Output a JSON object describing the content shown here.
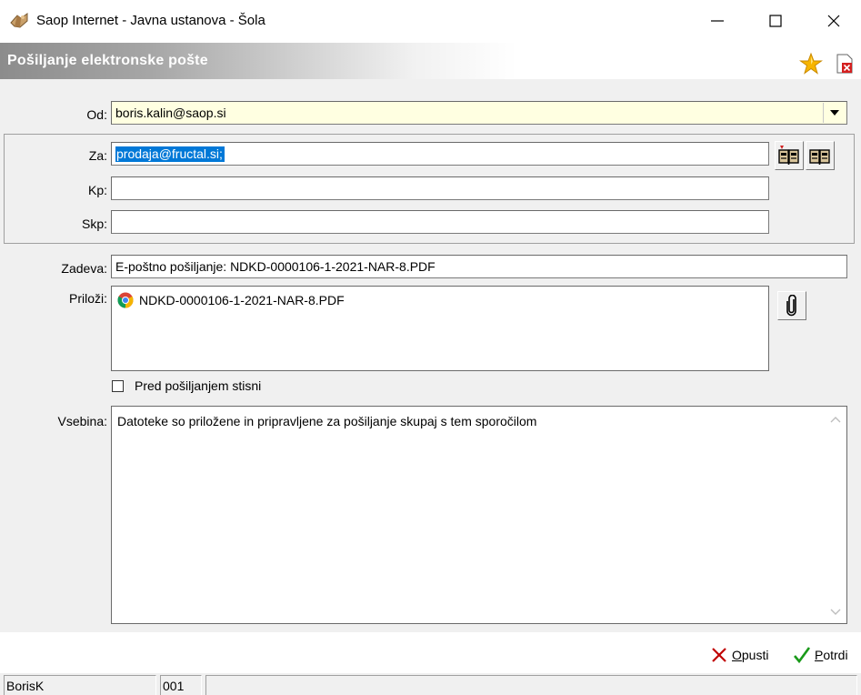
{
  "window": {
    "title": "Saop Internet - Javna ustanova - Šola"
  },
  "dialog": {
    "title": "Pošiljanje elektronske pošte"
  },
  "form": {
    "from_label": "Od:",
    "from_value": "boris.kalin@saop.si",
    "to_label": "Za:",
    "to_value": "prodaja@fructal.si;",
    "cc_label": "Kp:",
    "cc_value": "",
    "bcc_label": "Skp:",
    "bcc_value": "",
    "subject_label": "Zadeva:",
    "subject_value": "E-poštno pošiljanje: NDKD-0000106-1-2021-NAR-8.PDF",
    "attachments_label": "Priloži:",
    "attachments": [
      {
        "name": "NDKD-0000106-1-2021-NAR-8.PDF",
        "icon": "chrome-icon"
      }
    ],
    "compress_label": "Pred pošiljanjem stisni",
    "compress_checked": false,
    "body_label": "Vsebina:",
    "body_value": "Datoteke so priložene in pripravljene za pošiljanje skupaj s tem sporočilom"
  },
  "actions": {
    "cancel_label": "Opusti",
    "cancel_hotkey": "O",
    "cancel_rest": "pusti",
    "confirm_label": "Potrdi",
    "confirm_hotkey": "P",
    "confirm_rest": "otrdi"
  },
  "status": {
    "user": "BorisK",
    "code": "001",
    "message": ""
  },
  "colors": {
    "selection": "#0078d7",
    "from_field_bg": "#ffffe1",
    "cancel_icon": "#c00000",
    "confirm_icon": "#1a9a1a",
    "star_icon": "#f7b500"
  }
}
